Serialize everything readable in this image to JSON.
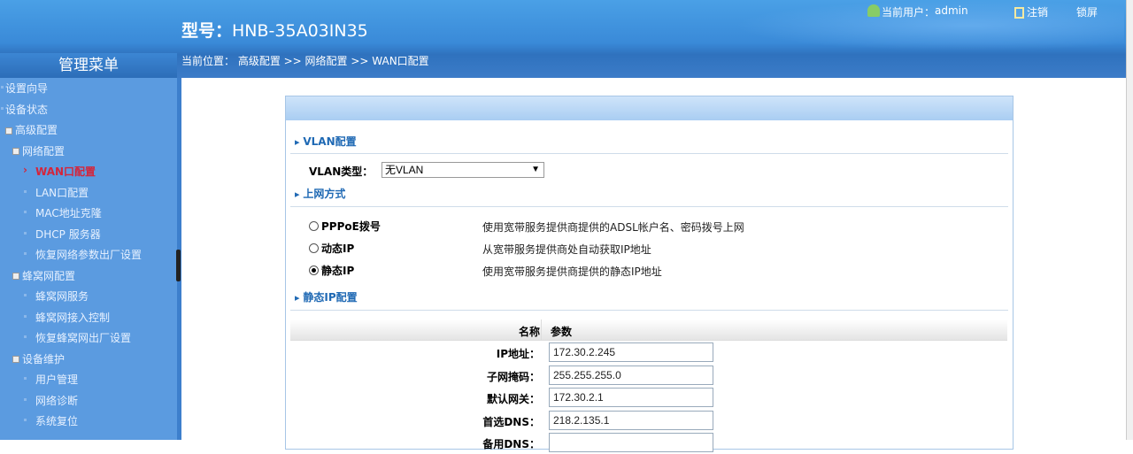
{
  "header": {
    "model_label": "型号：",
    "model": "HNB-35A03IN35",
    "user_label": "当前用户：",
    "user": "admin",
    "logout": "注销",
    "lock": "锁屏"
  },
  "menu_title": "管理菜单",
  "breadcrumb": "当前位置： 高级配置 >> 网络配置 >> WAN口配置",
  "sidebar": [
    {
      "label": "设置向导",
      "level": 0
    },
    {
      "label": "设备状态",
      "level": 0
    },
    {
      "label": "高级配置",
      "level": 0,
      "expanded": true
    },
    {
      "label": "网络配置",
      "level": 1,
      "expanded": true
    },
    {
      "label": "WAN口配置",
      "level": 2,
      "active": true
    },
    {
      "label": "LAN口配置",
      "level": 2
    },
    {
      "label": "MAC地址克隆",
      "level": 2
    },
    {
      "label": "DHCP 服务器",
      "level": 2
    },
    {
      "label": "恢复网络参数出厂设置",
      "level": 2
    },
    {
      "label": "蜂窝网配置",
      "level": 1,
      "expanded": true
    },
    {
      "label": "蜂窝网服务",
      "level": 2
    },
    {
      "label": "蜂窝网接入控制",
      "level": 2
    },
    {
      "label": "恢复蜂窝网出厂设置",
      "level": 2
    },
    {
      "label": "设备维护",
      "level": 1,
      "expanded": true
    },
    {
      "label": "用户管理",
      "level": 2
    },
    {
      "label": "网络诊断",
      "level": 2
    },
    {
      "label": "系统复位",
      "level": 2
    }
  ],
  "vlan": {
    "section": "VLAN配置",
    "type_label": "VLAN类型：",
    "type_value": "无VLAN"
  },
  "wan": {
    "section": "上网方式",
    "options": [
      {
        "label": "PPPoE拨号",
        "desc": "使用宽带服务提供商提供的ADSL帐户名、密码拨号上网",
        "checked": false
      },
      {
        "label": "动态IP",
        "desc": "从宽带服务提供商处自动获取IP地址",
        "checked": false
      },
      {
        "label": "静态IP",
        "desc": "使用宽带服务提供商提供的静态IP地址",
        "checked": true
      }
    ]
  },
  "static": {
    "section": "静态IP配置",
    "col_name": "名称",
    "col_param": "参数",
    "fields": [
      {
        "label": "IP地址：",
        "value": "172.30.2.245"
      },
      {
        "label": "子网掩码：",
        "value": "255.255.255.0"
      },
      {
        "label": "默认网关：",
        "value": "172.30.2.1"
      },
      {
        "label": "首选DNS：",
        "value": "218.2.135.1"
      },
      {
        "label": "备用DNS：",
        "value": ""
      }
    ]
  }
}
